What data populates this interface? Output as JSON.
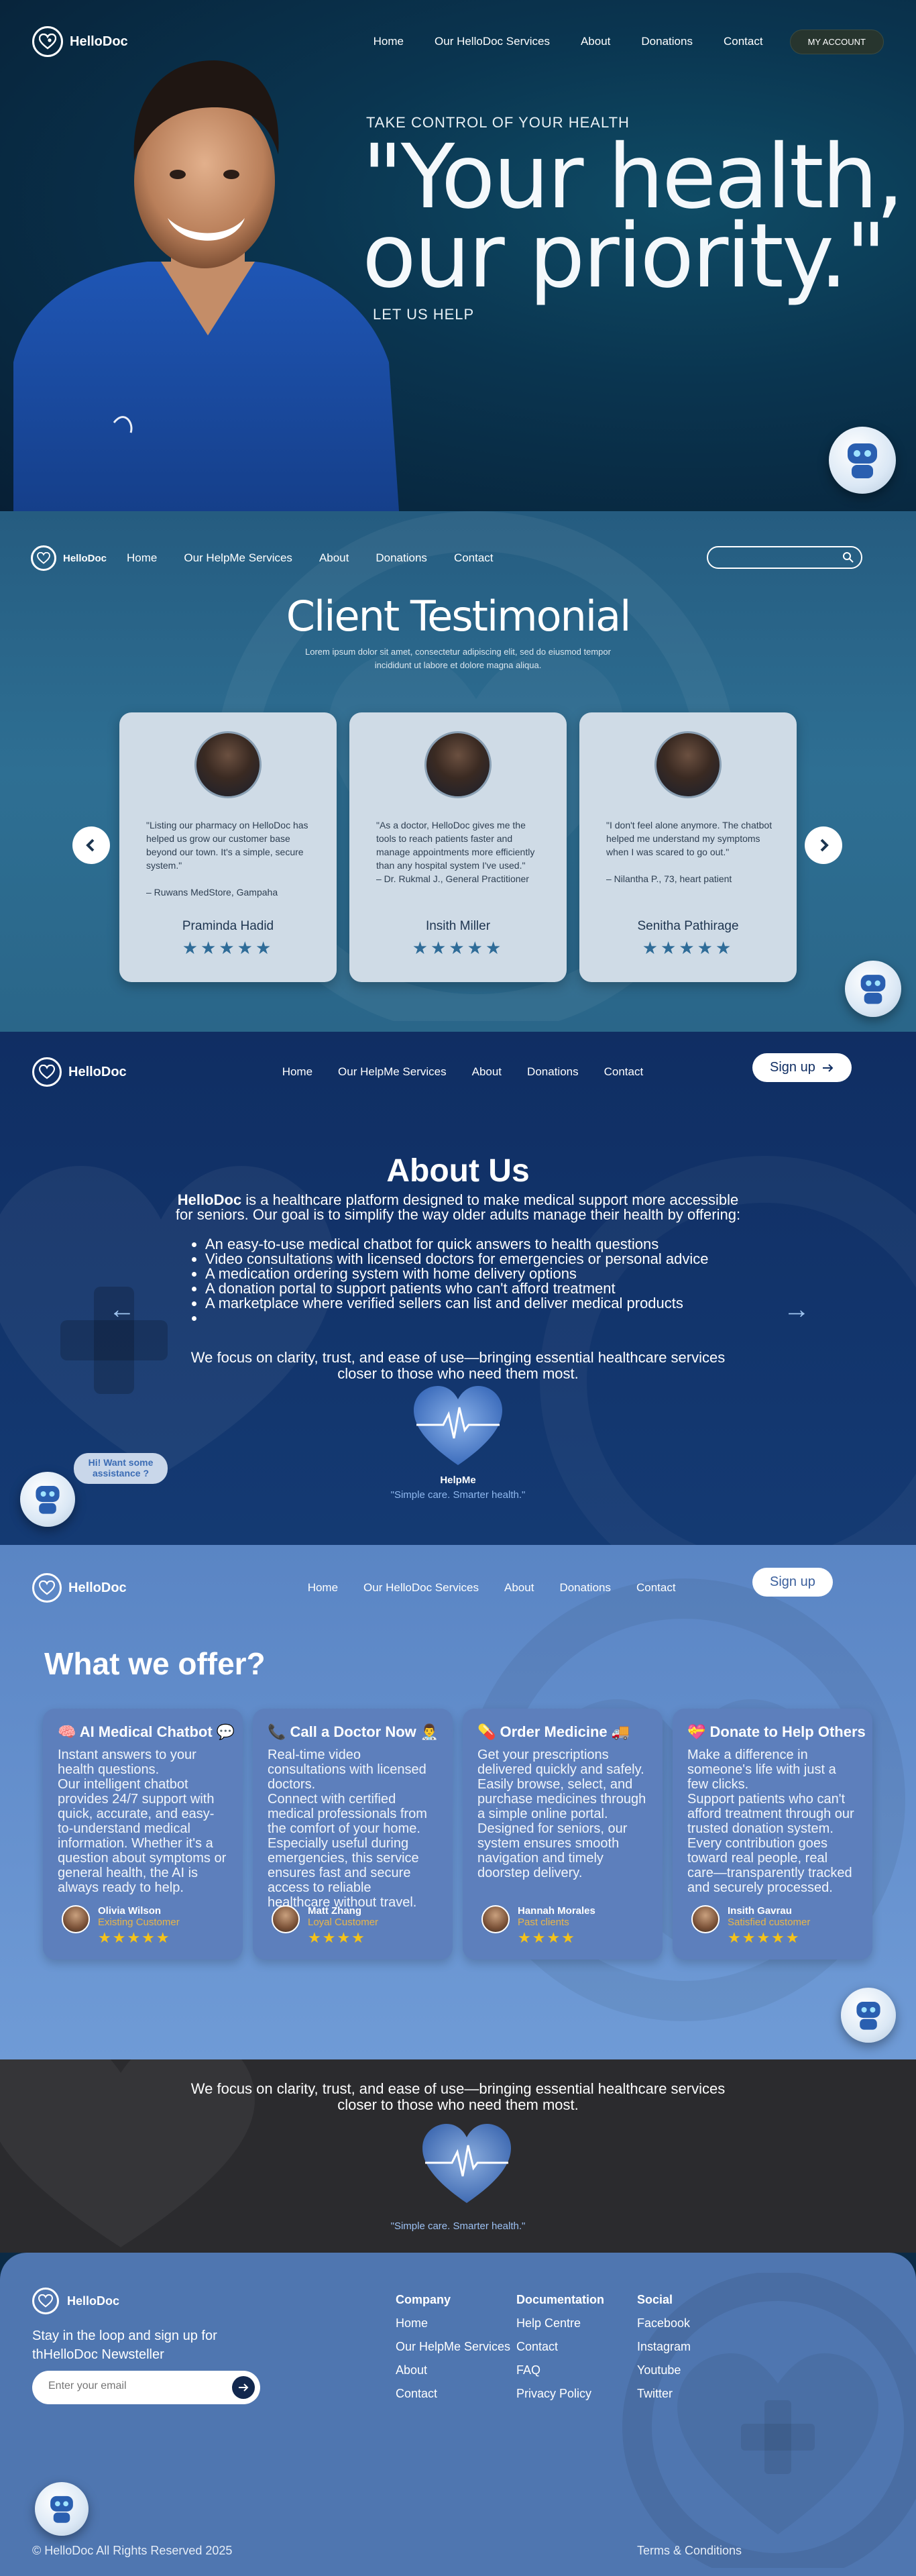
{
  "brand": {
    "name": "HelloDoc"
  },
  "hero": {
    "nav": [
      "Home",
      "Our HelloDoc Services",
      "About",
      "Donations",
      "Contact"
    ],
    "account_label": "MY ACCOUNT",
    "eyebrow": "TAKE CONTROL OF YOUR HEALTH",
    "title_line1": "\"Your health,",
    "title_line2": "our priority.\"",
    "cta": "LET US HELP"
  },
  "testimonial": {
    "nav": [
      "Home",
      "Our HelpMe Services",
      "About",
      "Donations",
      "Contact"
    ],
    "title": "Client Testimonial",
    "subtitle": "Lorem ipsum dolor sit amet, consectetur adipiscing elit, sed do eiusmod tempor incididunt ut labore et dolore magna aliqua.",
    "cards": [
      {
        "quote": "\"Listing our pharmacy on HelloDoc has helped us grow our customer base beyond our town. It's a simple, secure system.\"",
        "attribution": "– Ruwans MedStore, Gampaha",
        "name": "Praminda Hadid",
        "rating": 5
      },
      {
        "quote": "\"As a doctor, HelloDoc gives me the tools to reach patients faster and manage appointments more efficiently than any hospital system I've used.\"",
        "attribution": "– Dr. Rukmal J., General Practitioner",
        "name": "Insith Miller",
        "rating": 5
      },
      {
        "quote": "\"I don't feel alone anymore. The chatbot helped me understand my symptoms when I was scared to go out.\"",
        "attribution": "– Nilantha P., 73, heart patient",
        "name": "Senitha Pathirage",
        "rating": 5
      }
    ]
  },
  "about": {
    "nav": [
      "Home",
      "Our HelpMe Services",
      "About",
      "Donations",
      "Contact"
    ],
    "signup": "Sign up",
    "title": "About Us",
    "intro_brand": "HelloDoc",
    "intro_rest": " is a healthcare platform designed to make medical support more accessible for seniors. Our goal is to simplify the way older adults manage their health by offering:",
    "items": [
      "An easy-to-use medical chatbot for quick answers to health questions",
      "Video consultations with licensed doctors for emergencies or personal advice",
      "A medication ordering system with home delivery options",
      "A donation portal to support patients who can't afford treatment",
      "A marketplace where verified sellers can list and deliver medical products",
      ""
    ],
    "closing": "We focus on clarity, trust, and ease of use—bringing essential healthcare services closer to those who need them most.",
    "helpme_name": "HelpMe",
    "helpme_tagline": "\"Simple care. Smarter health.\"",
    "chat_bubble": "Hi! Want some assistance ?"
  },
  "offer": {
    "nav": [
      "Home",
      "Our HelloDoc Services",
      "About",
      "Donations",
      "Contact"
    ],
    "signup": "Sign up",
    "title": "What we offer?",
    "cards": [
      {
        "title": "🧠 AI Medical Chatbot 💬",
        "body": "Instant answers to your health questions.\n Our intelligent chatbot provides 24/7 support with quick, accurate, and easy-to-understand medical information. Whether it's a question about symptoms or general health, the AI is always ready to help.",
        "reviewer": "Olivia Wilson",
        "role": "Existing Customer",
        "rating": 5
      },
      {
        "title": "📞 Call a Doctor Now 👨‍⚕️",
        "body": "Real-time video consultations with licensed doctors.\n Connect with certified medical professionals from the comfort of your home. Especially useful during emergencies, this service ensures fast and secure access to reliable healthcare without travel.",
        "reviewer": "Matt Zhang",
        "role": "Loyal Customer",
        "rating": 4
      },
      {
        "title": "💊 Order Medicine 🚚",
        "body": "Get your prescriptions delivered quickly and safely.\n Easily browse, select, and purchase medicines through a simple online portal. Designed for seniors, our system ensures smooth navigation and timely doorstep delivery.",
        "reviewer": "Hannah Morales",
        "role": "Past clients",
        "rating": 4
      },
      {
        "title": "💝 Donate to Help Others",
        "body": "Make a difference in someone's life with just a few clicks.\n Support patients who can't afford treatment through our trusted donation system.\n Every contribution goes toward real people, real care—transparently tracked and securely processed.",
        "reviewer": "Insith Gavrau",
        "role": "Satisfied customer",
        "rating": 5
      }
    ]
  },
  "band": {
    "text": "We focus on clarity, trust, and ease of use—bringing essential healthcare services closer to those who need them most.",
    "tagline": "\"Simple care. Smarter health.\""
  },
  "footer": {
    "newsletter": "Stay in the loop and sign up for thHelloDoc Newsteller",
    "email_placeholder": "Enter your email",
    "columns": [
      {
        "title": "Company",
        "links": [
          "Home",
          "Our HelpMe Services",
          "About",
          "Contact"
        ]
      },
      {
        "title": "Documentation",
        "links": [
          "Help Centre",
          "Contact",
          "FAQ",
          "Privacy Policy"
        ]
      },
      {
        "title": "Social",
        "links": [
          "Facebook",
          "Instagram",
          "Youtube",
          "Twitter"
        ]
      }
    ],
    "copyright": "© HelloDoc All Rights Reserved 2025",
    "terms": "Terms & Conditions"
  },
  "colors": {
    "hero_bg": "#0a3550",
    "testimonial_bg": "#2e6f93",
    "about_bg": "#143a73",
    "offer_bg": "#6792cf",
    "band_bg": "#2b2b2e",
    "footer_bg": "#4f76b0",
    "star": "#f4c21a"
  }
}
